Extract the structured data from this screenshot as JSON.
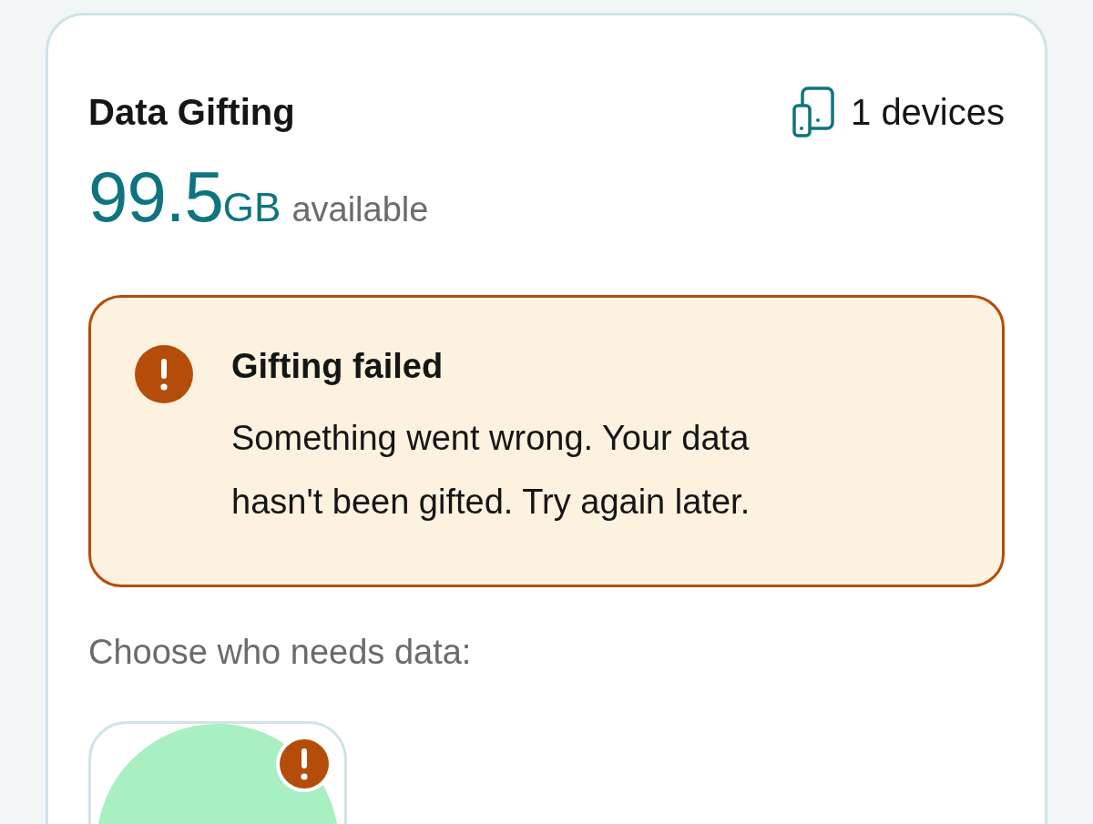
{
  "card": {
    "title": "Data Gifting",
    "devices": "1 devices",
    "amount": "99.5",
    "unit": "GB",
    "amount_label": "available"
  },
  "alert": {
    "title": "Gifting failed",
    "message": "Something went wrong. Your data hasn't been gifted. Try again later."
  },
  "recipients_prompt": "Choose who needs data:",
  "recipients": [
    {
      "failed": true
    }
  ]
}
